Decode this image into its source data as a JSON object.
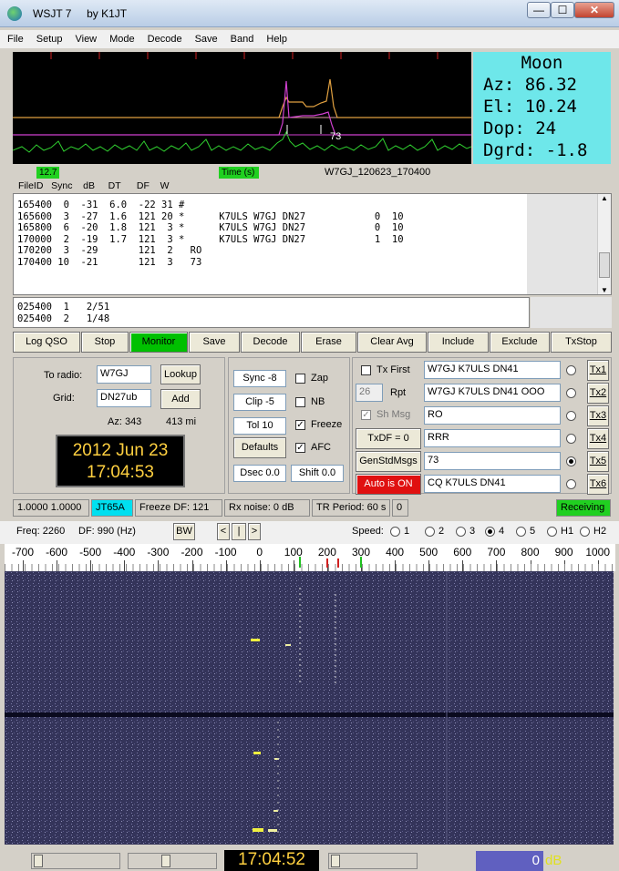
{
  "window": {
    "title": "WSJT 7",
    "author": "by K1JT",
    "min_label": "—",
    "max_label": "☐",
    "close_label": "✕"
  },
  "menu": [
    "File",
    "Setup",
    "View",
    "Mode",
    "Decode",
    "Save",
    "Band",
    "Help"
  ],
  "moon": {
    "heading": "Moon",
    "az": "Az:  86.32",
    "el": "El:  10.24",
    "dop": "Dop:    24",
    "dgrd": "Dgrd: -1.8"
  },
  "wave": {
    "marker_label": "73"
  },
  "infobar": {
    "level": "12.7",
    "time_label": "Time (s)",
    "filename": "W7GJ_120623_170400"
  },
  "decode_header": "FileID   Sync    dB     DT      DF    W",
  "decodes": [
    "165400  0  -31  6.0  -22 31 #",
    "165600  3  -27  1.6  121 20 *      K7ULS W7GJ DN27            0  10",
    "165800  6  -20  1.8  121  3 *      K7ULS W7GJ DN27            0  10",
    "170000  2  -19  1.7  121  3 *      K7ULS W7GJ DN27            1  10",
    "170200  3  -29       121  2   RO",
    "170400 10  -21       121  3   73"
  ],
  "averages": [
    "025400  1   2/51",
    "025400  2   1/48"
  ],
  "buttons": {
    "log_qso": "Log QSO",
    "stop": "Stop",
    "monitor": "Monitor",
    "save": "Save",
    "decode": "Decode",
    "erase": "Erase",
    "clear_avg": "Clear Avg",
    "include": "Include",
    "exclude": "Exclude",
    "txstop": "TxStop"
  },
  "left": {
    "to_radio_label": "To radio:",
    "to_radio_value": "W7GJ",
    "grid_label": "Grid:",
    "grid_value": "DN27ub",
    "lookup": "Lookup",
    "add": "Add",
    "az": "Az: 343",
    "distance": "413 mi",
    "date": "2012 Jun 23",
    "time": "17:04:53"
  },
  "mid": {
    "sync": "Sync  -8",
    "clip": "Clip  -5",
    "tol": "Tol   10",
    "zap": "Zap",
    "nb": "NB",
    "freeze": "Freeze",
    "afc": "AFC",
    "defaults": "Defaults",
    "dsec": "Dsec  0.0",
    "shift": "Shift 0.0"
  },
  "tx": {
    "tx_first": "Tx First",
    "rpt_value": "26",
    "rpt": "Rpt",
    "sh_msg": "Sh Msg",
    "txdf": "TxDF = 0",
    "genstd": "GenStdMsgs",
    "auto": "Auto is ON",
    "messages": [
      "W7GJ K7ULS DN41",
      "W7GJ K7ULS DN41 OOO",
      "RO",
      "RRR",
      "73",
      "CQ K7ULS DN41"
    ],
    "tx_labels": [
      "Tx1",
      "Tx2",
      "Tx3",
      "Tx4",
      "Tx5",
      "Tx6"
    ],
    "selected": "Tx5"
  },
  "status": {
    "ratio": "1.0000 1.0000",
    "mode": "JT65A",
    "freeze_df": "Freeze DF: 121",
    "rx_noise": "Rx noise:  0 dB",
    "tr_period": "TR Period: 60 s",
    "count": "0",
    "state": "Receiving"
  },
  "wf": {
    "freq": "Freq:  2260",
    "df": "DF:   990  (Hz)",
    "bw": "BW",
    "prev": "<",
    "bar": "|",
    "next": ">",
    "speed_label": "Speed:",
    "speed_opts": [
      "1",
      "2",
      "3",
      "4",
      "5",
      "H1",
      "H2"
    ],
    "speed_selected": "4",
    "ticks": [
      "-700",
      "-600",
      "-500",
      "-400",
      "-300",
      "-200",
      "-100",
      "0",
      "100",
      "200",
      "300",
      "400",
      "500",
      "600",
      "700",
      "800",
      "900",
      "1000"
    ]
  },
  "bottom": {
    "clock": "17:04:52",
    "level": "0",
    "unit": "dB"
  },
  "colors": {
    "green": "#20d020",
    "cyan": "#6ee7ea",
    "red": "#e01010",
    "monitor_green": "#00c000",
    "waterfall": "#34345a"
  }
}
